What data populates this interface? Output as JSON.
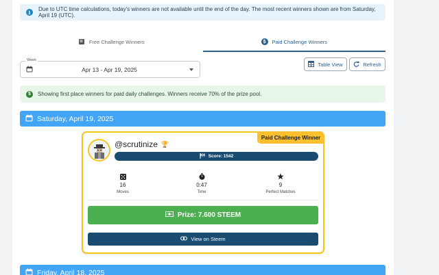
{
  "info_banner": {
    "text": "Due to UTC time calculations, today's winners are not available until the end of the day. The most recent winners shown are from Saturday, April 19 (UTC).",
    "icon": "info-icon"
  },
  "tabs": [
    {
      "label": "Free Challenge Winners",
      "icon": "book-icon",
      "active": false
    },
    {
      "label": "Paid Challenge Winners",
      "icon": "dollar-icon",
      "active": true
    }
  ],
  "week_select": {
    "label": "Week",
    "value": "Apr 13 - Apr 19, 2025"
  },
  "buttons": {
    "table_view": "Table View",
    "refresh": "Refresh"
  },
  "success_banner": {
    "text": "Showing first place winners for paid daily challenges. Winners receive 70% of the prize pool."
  },
  "days": [
    {
      "date": "Saturday, April 19, 2025",
      "winner": {
        "badge": "Paid Challenge Winner",
        "username": "@scrutinize",
        "score_text": "Score: 1542",
        "stats": [
          {
            "value": "16",
            "label": "Moves",
            "icon": "dice-icon"
          },
          {
            "value": "0:47",
            "label": "Time",
            "icon": "stopwatch-icon"
          },
          {
            "value": "9",
            "label": "Perfect Matches",
            "icon": "star-icon"
          }
        ],
        "prize_text": "Prize: 7.600 STEEM",
        "view_link": "View on Steem"
      }
    },
    {
      "date": "Friday, April 18, 2025"
    }
  ],
  "colors": {
    "accent_blue": "#42a5f5",
    "navy": "#1a4c72",
    "green": "#4caf50",
    "gold": "#fbc02d"
  }
}
